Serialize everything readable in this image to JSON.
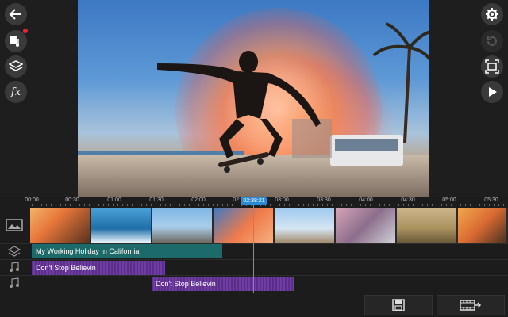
{
  "app": {
    "accent": "#2b8ad6",
    "text_track_color": "#1d6a6a",
    "audio_track_color": "#6a3a9c"
  },
  "left_toolbar": [
    {
      "name": "back-icon"
    },
    {
      "name": "media-music-icon",
      "badge": "red"
    },
    {
      "name": "layers-icon"
    },
    {
      "name": "fx-icon",
      "label": "fx"
    }
  ],
  "right_toolbar": [
    {
      "name": "gear-icon"
    },
    {
      "name": "undo-icon"
    },
    {
      "name": "fullscreen-icon"
    },
    {
      "name": "play-icon"
    }
  ],
  "timeline": {
    "ticks": [
      "00:00",
      "00:30",
      "01:00",
      "01:30",
      "02:00",
      "02:30",
      "03:00",
      "03:30",
      "04:00",
      "04:30",
      "05:00",
      "05:30"
    ],
    "playhead_time": "02:38:21",
    "video_clips": [
      "sunset-jump",
      "surfer",
      "bmx-rider",
      "skateboarder",
      "street-jumper",
      "blurred-crowd",
      "cyclist",
      "beach-jump"
    ],
    "text_track": {
      "label": "My Working Holiday In California"
    },
    "audio_tracks": [
      {
        "label": "Don't Stop Believin"
      },
      {
        "label": "Don't Stop Believin"
      }
    ]
  },
  "bottom_bar": [
    {
      "name": "save-icon"
    },
    {
      "name": "produce-video-icon"
    }
  ]
}
